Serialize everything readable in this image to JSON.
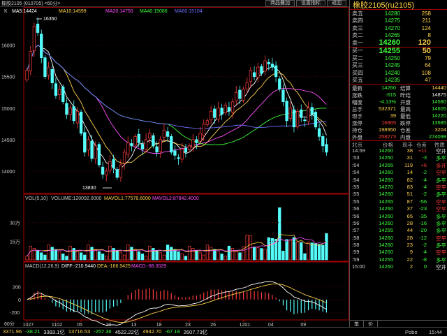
{
  "titlebar": {
    "title": "橡胶2105 (010705) <60分>",
    "buttons": [
      "商品叠加",
      "设置指标",
      "返回"
    ]
  },
  "main_legend": {
    "label": "K",
    "ma5": "MA5:14424",
    "ma10": "MA10:14599",
    "ma20": "MA20:14750",
    "ma40": "MA40:15086",
    "ma60": "MA60:15104"
  },
  "annotations": {
    "high": "16350",
    "low": "13830"
  },
  "vol_legend": {
    "label": "VOL(5,10)",
    "volume": "VOLUME:120092.0000",
    "mavol1": "MAVOL1:77578.6000",
    "mavol2": "MAVOL2:87842.4000"
  },
  "macd_legend": {
    "label": "MACD(12,26,9)",
    "diff": "DIFF:-210.9440",
    "dea": "DEA:-166.9425",
    "macd": "MACD:-88.0029"
  },
  "period_label": "60分",
  "chart_data": [
    {
      "type": "candlestick",
      "yaxis_ticks": [
        "16000",
        "15500",
        "15000",
        "14500",
        "14000"
      ],
      "ylim": [
        13700,
        16450
      ],
      "xaxis_ticks": [
        "1027",
        "1102",
        "05",
        "10",
        "13",
        "18",
        "23",
        "26",
        "1201",
        "04",
        "09"
      ],
      "moving_averages": [
        "MA5",
        "MA10",
        "MA20",
        "MA40",
        "MA60"
      ],
      "colors": {
        "up": "#ff3c3c",
        "down": "#54fcfc",
        "ma5": "#ffffff",
        "ma10": "#ffd24a",
        "ma20": "#ff50ff",
        "ma40": "#3cff3c",
        "ma60": "#7070ff"
      },
      "close": [
        15600,
        15900,
        16300,
        16200,
        15800,
        15500,
        15650,
        15400,
        15200,
        15300,
        15100,
        14900,
        15000,
        14800,
        14950,
        14600,
        14300,
        14500,
        14200,
        14400,
        14100,
        13950,
        14000,
        14150,
        14050,
        13900,
        14100,
        14300,
        14450,
        14400,
        14550,
        14450,
        14350,
        14500,
        14600,
        14400,
        14300,
        14500,
        14650,
        14550,
        14300,
        14250,
        14200,
        14350,
        14300,
        14400,
        14500,
        14450,
        14600,
        14750,
        14800,
        14950,
        14850,
        15000,
        14900,
        15050,
        14950,
        15100,
        15250,
        15150,
        15300,
        15400,
        15600,
        15500,
        15650,
        15550,
        15750,
        15700,
        15650,
        15500,
        15300,
        15100,
        14800,
        15000,
        14700,
        14950,
        14850,
        14800,
        15000,
        14900,
        14700,
        14550,
        14400,
        14300
      ]
    },
    {
      "type": "bar",
      "name": "VOL",
      "yaxis_ticks": [
        "30万",
        "15万"
      ],
      "ylim": [
        0,
        450000
      ]
    },
    {
      "type": "bar",
      "name": "MACD",
      "yaxis_ticks": [
        "200",
        "0",
        "-200"
      ],
      "ylim": [
        -300,
        450
      ]
    }
  ],
  "quote": {
    "title": "橡胶2105(ru2105)",
    "asks": [
      {
        "label": "卖五",
        "price": "14280",
        "vol": "258"
      },
      {
        "label": "卖四",
        "price": "14275",
        "vol": "211"
      },
      {
        "label": "卖三",
        "price": "14270",
        "vol": "124"
      },
      {
        "label": "卖二",
        "price": "14265",
        "vol": "8"
      }
    ],
    "ask1": {
      "label": "卖一",
      "price": "14260",
      "vol": "120"
    },
    "bid1": {
      "label": "买一",
      "price": "14255",
      "vol": "50"
    },
    "bids": [
      {
        "label": "买二",
        "price": "14250",
        "vol": "79"
      },
      {
        "label": "买三",
        "price": "14245",
        "vol": "64"
      },
      {
        "label": "买四",
        "price": "14240",
        "vol": "108"
      },
      {
        "label": "买五",
        "price": "14235",
        "vol": "47"
      }
    ],
    "stats": [
      {
        "k1": "最新",
        "v1": "14260",
        "c1": "green",
        "k2": "结算",
        "v2": "14440",
        "c2": "yellow"
      },
      {
        "k1": "涨跌",
        "v1": "-615",
        "c1": "green",
        "k2": "昨结",
        "v2": "14875",
        "c2": "white"
      },
      {
        "k1": "幅度",
        "v1": "-4.13%",
        "c1": "green",
        "k2": "开盘",
        "v2": "14580",
        "c2": "green"
      },
      {
        "k1": "总手",
        "v1": "532371",
        "c1": "yellow",
        "k2": "最高",
        "v2": "14605",
        "c2": "green"
      },
      {
        "k1": "现手",
        "v1": "39",
        "c1": "yellow",
        "k2": "最低",
        "v2": "14220",
        "c2": "green"
      },
      {
        "k1": "涨停",
        "v1": "16865",
        "c1": "red",
        "k2": "跌停",
        "v2": "13685",
        "c2": "green"
      },
      {
        "k1": "持仓",
        "v1": "198950",
        "c1": "yellow",
        "k2": "仓差",
        "v2": "3204",
        "c2": "yellow"
      },
      {
        "k1": "外盘",
        "v1": "258273",
        "c1": "red",
        "k2": "内盘",
        "v2": "274098",
        "c2": "green"
      }
    ],
    "ticks_header": {
      "time": "北京",
      "price": "价格",
      "vol": "现手",
      "chg": "仓差",
      "type": "性质"
    },
    "ticks": [
      {
        "time": "14:59",
        "price": "14260",
        "vol": "38",
        "chg": "+11",
        "type": "空开",
        "tcls": "white"
      },
      {
        "time": ":53",
        "price": "14260",
        "vol": "31",
        "chg": "-3",
        "type": "多平",
        "tcls": "green"
      },
      {
        "time": ":54",
        "price": "14265",
        "vol": "119",
        "chg": "+6",
        "type": "多开",
        "tcls": "red"
      },
      {
        "time": ":54",
        "price": "14260",
        "vol": "14",
        "chg": "-2",
        "type": "空平",
        "tcls": "red"
      },
      {
        "time": ":54",
        "price": "14260",
        "vol": "82",
        "chg": "-4",
        "type": "多平",
        "tcls": "green"
      },
      {
        "time": ":55",
        "price": "14270",
        "vol": "83",
        "chg": "-4",
        "type": "空平",
        "tcls": "red"
      },
      {
        "time": ":55",
        "price": "14260",
        "vol": "51",
        "chg": "-2",
        "type": "多平",
        "tcls": "green"
      },
      {
        "time": ":55",
        "price": "14265",
        "vol": "87",
        "chg": "-56",
        "type": "空平",
        "tcls": "red"
      },
      {
        "time": ":56",
        "price": "14260",
        "vol": "37",
        "chg": "-23",
        "type": "空平",
        "tcls": "red"
      },
      {
        "time": ":56",
        "price": "14260",
        "vol": "65",
        "chg": "-35",
        "type": "多平",
        "tcls": "green"
      },
      {
        "time": ":56",
        "price": "14260",
        "vol": "28",
        "chg": "-16",
        "type": "多平",
        "tcls": "green"
      },
      {
        "time": ":57",
        "price": "14255",
        "vol": "44",
        "chg": "-20",
        "type": "多平",
        "tcls": "green"
      },
      {
        "time": ":58",
        "price": "14260",
        "vol": "28",
        "chg": "-12",
        "type": "空平",
        "tcls": "red"
      },
      {
        "time": ":58",
        "price": "14260",
        "vol": "23",
        "chg": "-2",
        "type": "多平",
        "tcls": "green"
      },
      {
        "time": ":59",
        "price": "14260",
        "vol": "9",
        "chg": "-4",
        "type": "空平",
        "tcls": "red"
      },
      {
        "time": ":59",
        "price": "14255",
        "vol": "22",
        "chg": "-8",
        "type": "多平",
        "tcls": "green"
      },
      {
        "time": "15:00",
        "price": "14260",
        "vol": "2",
        "chg": "0",
        "type": "空开",
        "tcls": "white"
      }
    ],
    "tabs": [
      "笔",
      "价"
    ]
  },
  "statusbar": {
    "items": [
      {
        "text": "3371.96",
        "cls": "yellow"
      },
      {
        "text": "-38.21",
        "cls": "green"
      },
      {
        "text": "3393.1亿",
        "cls": "white"
      },
      {
        "text": "13716.53",
        "cls": "yellow"
      },
      {
        "text": "-257.36",
        "cls": "green"
      },
      {
        "text": "4522.22亿",
        "cls": "white"
      },
      {
        "text": "4942.70",
        "cls": "yellow"
      },
      {
        "text": "-67.18",
        "cls": "green"
      },
      {
        "text": "2607.73亿",
        "cls": "white"
      }
    ],
    "brand": "Pobo",
    "clock": "15:44"
  }
}
